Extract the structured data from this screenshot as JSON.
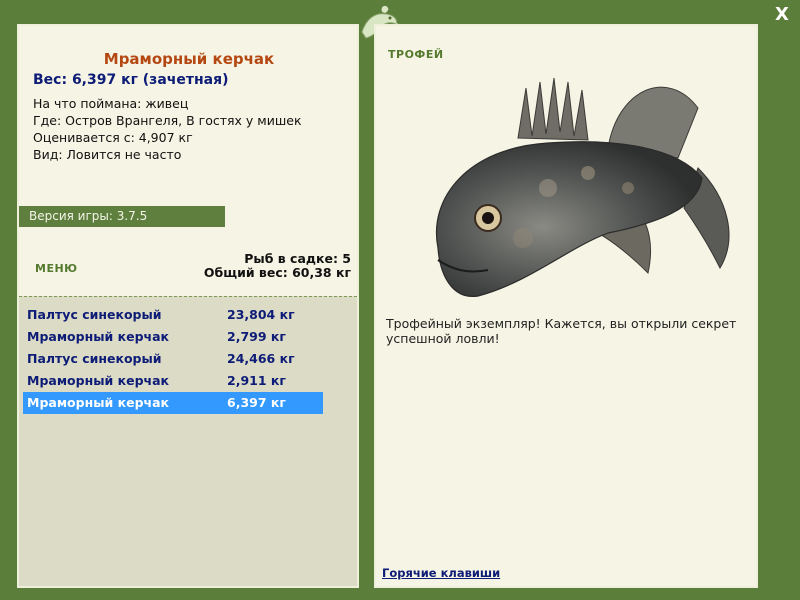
{
  "window": {
    "close_label": "X"
  },
  "fish": {
    "name": "Мраморный керчак",
    "weight_line": "Вес: 6,397 кг (зачетная)",
    "bait": "На что поймана: живец",
    "location": "Где: Остров Врангеля, В гостях у мишек",
    "value": "Оценивается с: 4,907 кг",
    "rarity": "Вид: Ловится не часто"
  },
  "version": "Версия игры: 3.7.5",
  "menu_label": "МЕНЮ",
  "stats": {
    "count": "Рыб в садке: 5",
    "total": "Общий вес: 60,38 кг"
  },
  "catch_list": [
    {
      "name": "Палтус синекорый",
      "weight": "23,804 кг"
    },
    {
      "name": "Мраморный керчак",
      "weight": "2,799 кг"
    },
    {
      "name": "Палтус синекорый",
      "weight": "24,466 кг"
    },
    {
      "name": "Мраморный керчак",
      "weight": "2,911 кг"
    },
    {
      "name": "Мраморный керчак",
      "weight": "6,397 кг"
    }
  ],
  "selected_index": 4,
  "trophy_label": "ТРОФЕЙ",
  "description": "Трофейный экземпляр! Кажется, вы открыли секрет успешной ловли!",
  "hotkeys_label": "Горячие клавиши",
  "colors": {
    "frame": "#5c7e3b",
    "panel": "#f6f4e4",
    "title": "#b54812",
    "link": "#0d1c76",
    "selection": "#3399ff"
  }
}
